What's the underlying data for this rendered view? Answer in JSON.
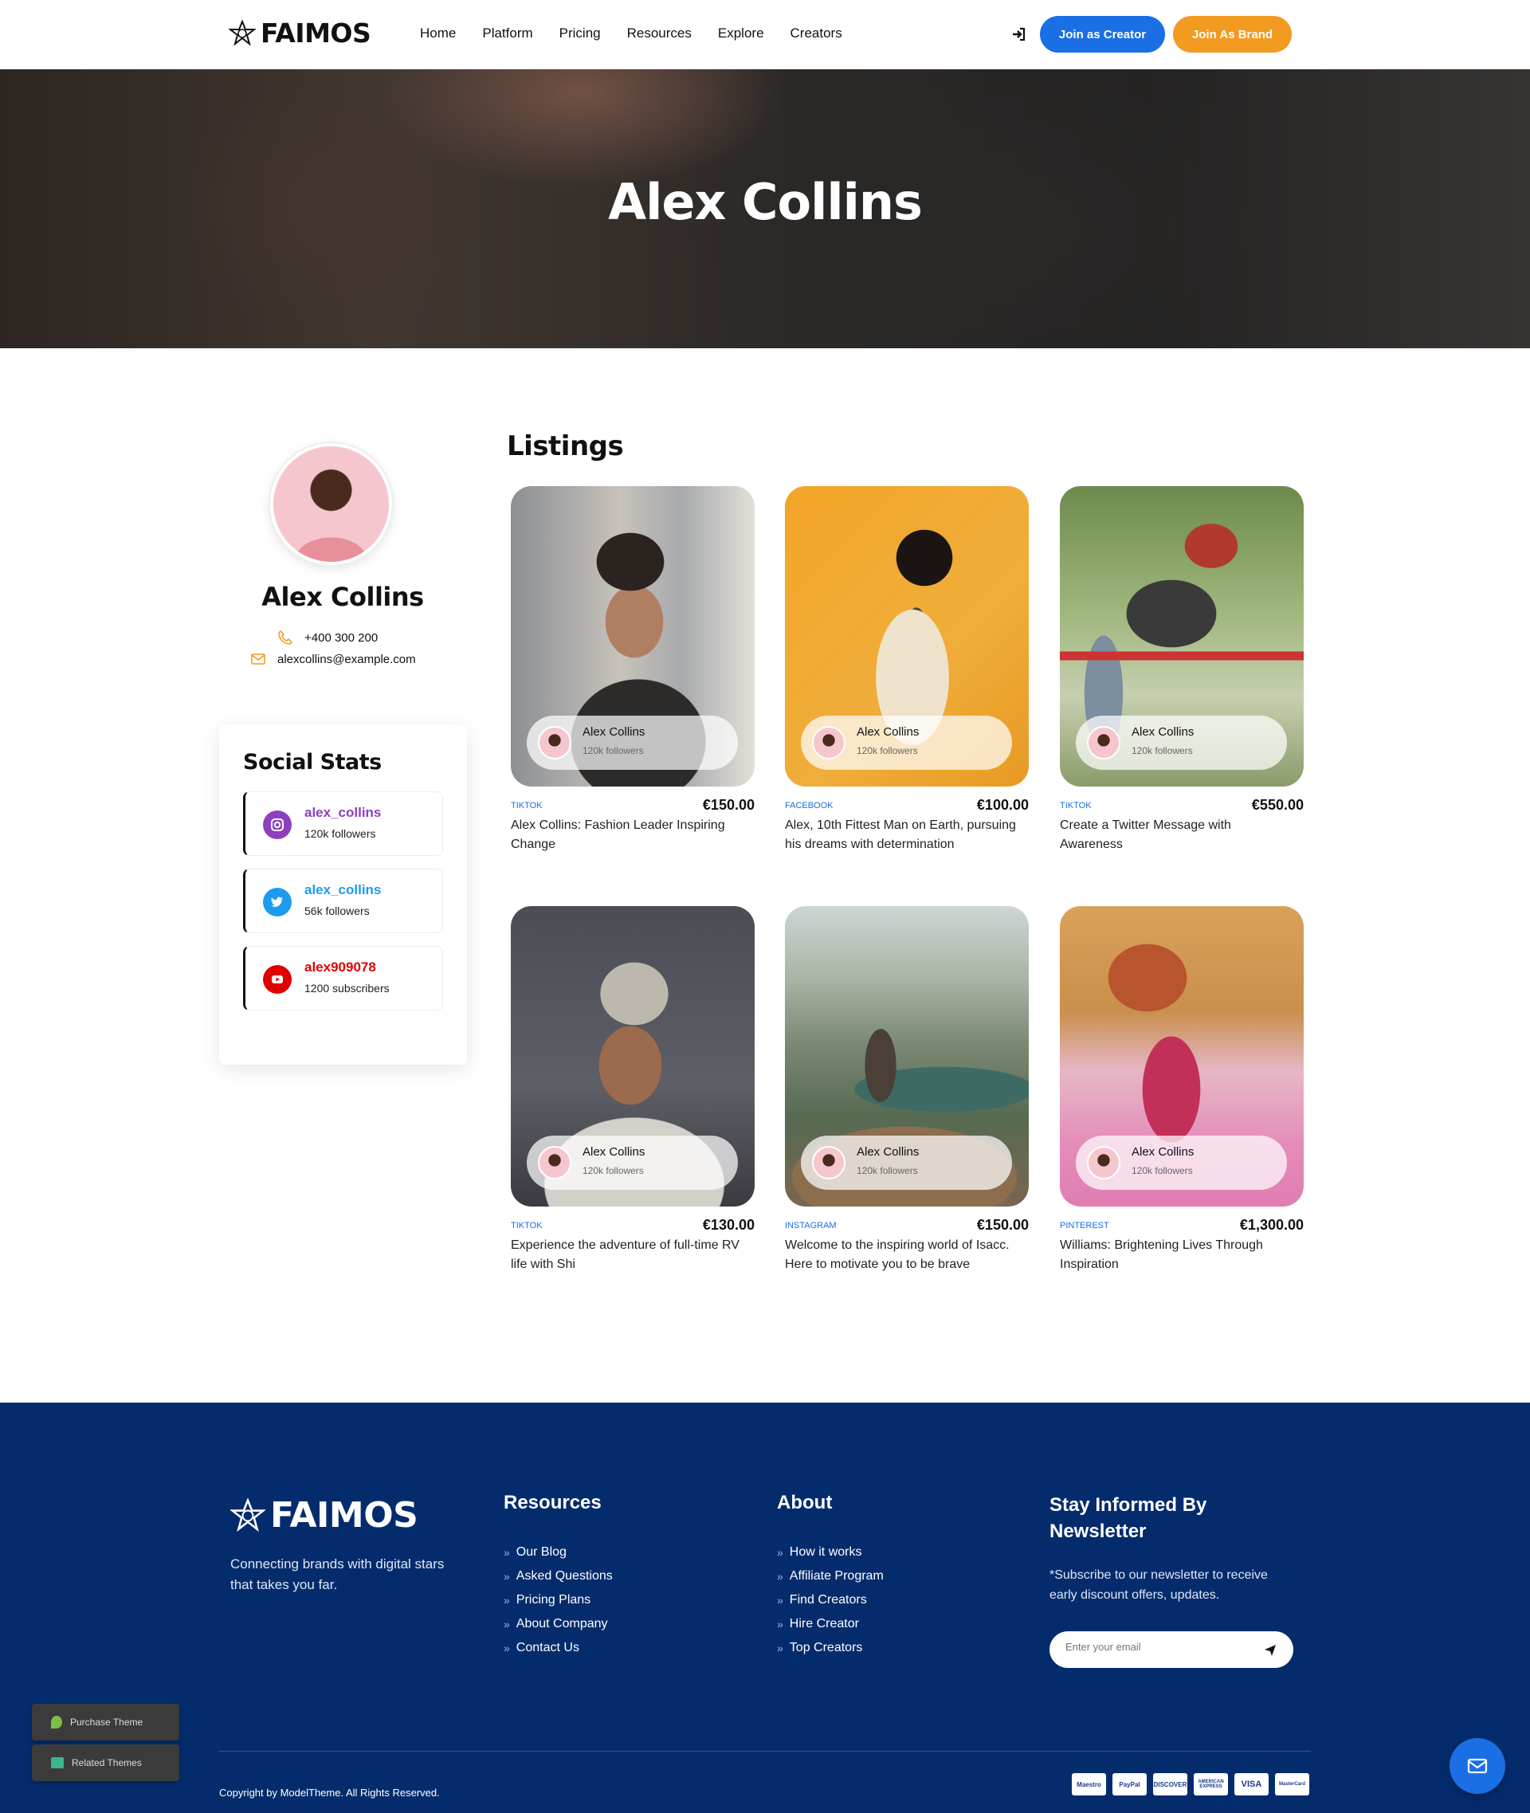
{
  "header": {
    "logo_text": "FAIMOS",
    "nav": [
      "Home",
      "Platform",
      "Pricing",
      "Resources",
      "Explore",
      "Creators"
    ],
    "join_creator": "Join as Creator",
    "join_brand": "Join As Brand"
  },
  "hero": {
    "title": "Alex Collins"
  },
  "profile": {
    "name": "Alex Collins",
    "phone": "+400 300 200",
    "email": "alexcollins@example.com"
  },
  "social_stats": {
    "title": "Social Stats",
    "items": [
      {
        "handle": "alex_collins",
        "count": "120k followers",
        "icon": "instagram-icon",
        "color": "#8e3fc0"
      },
      {
        "handle": "alex_collins",
        "count": "56k followers",
        "icon": "twitter-icon",
        "color": "#1d9bf0"
      },
      {
        "handle": "alex909078",
        "count": "1200 subscribers",
        "icon": "youtube-icon",
        "color": "#e00000"
      }
    ]
  },
  "listings": {
    "title": "Listings",
    "cards": [
      {
        "platform": "TIKTOK",
        "price": "€150.00",
        "title": "Alex Collins: Fashion Leader Inspiring Change",
        "creator": "Alex Collins",
        "followers": "120k followers"
      },
      {
        "platform": "FACEBOOK",
        "price": "€100.00",
        "title": "Alex, 10th Fittest Man on Earth, pursuing his dreams with determination",
        "creator": "Alex Collins",
        "followers": "120k followers"
      },
      {
        "platform": "TIKTOK",
        "price": "€550.00",
        "title": "Create a Twitter Message with Awareness",
        "creator": "Alex Collins",
        "followers": "120k followers"
      },
      {
        "platform": "TIKTOK",
        "price": "€130.00",
        "title": "Experience the adventure of full-time RV life with Shi",
        "creator": "Alex Collins",
        "followers": "120k followers"
      },
      {
        "platform": "INSTAGRAM",
        "price": "€150.00",
        "title": "Welcome to the inspiring world of Isacc. Here to motivate you to be brave",
        "creator": "Alex Collins",
        "followers": "120k followers"
      },
      {
        "platform": "PINTEREST",
        "price": "€1,300.00",
        "title": "Williams: Brightening Lives Through Inspiration",
        "creator": "Alex Collins",
        "followers": "120k followers"
      }
    ]
  },
  "footer": {
    "logo_text": "FAIMOS",
    "tagline": "Connecting brands with digital stars that takes you far.",
    "resources_title": "Resources",
    "resources": [
      "Our Blog",
      "Asked Questions",
      "Pricing Plans",
      "About Company",
      "Contact Us"
    ],
    "about_title": "About",
    "about": [
      "How it works",
      "Affiliate Program",
      "Find Creators",
      "Hire Creator",
      "Top Creators"
    ],
    "newsletter_title": "Stay Informed By Newsletter",
    "newsletter_text": "*Subscribe to our newsletter to receive early discount offers, updates.",
    "email_placeholder": "Enter your email",
    "copyright": "Copyright by ModelTheme. All Rights Reserved.",
    "payments": [
      "Maestro",
      "PayPal",
      "DISCOVER",
      "AMERICAN EXPRESS",
      "VISA",
      "MasterCard"
    ]
  },
  "floating": {
    "purchase": "Purchase Theme",
    "related": "Related Themes"
  }
}
